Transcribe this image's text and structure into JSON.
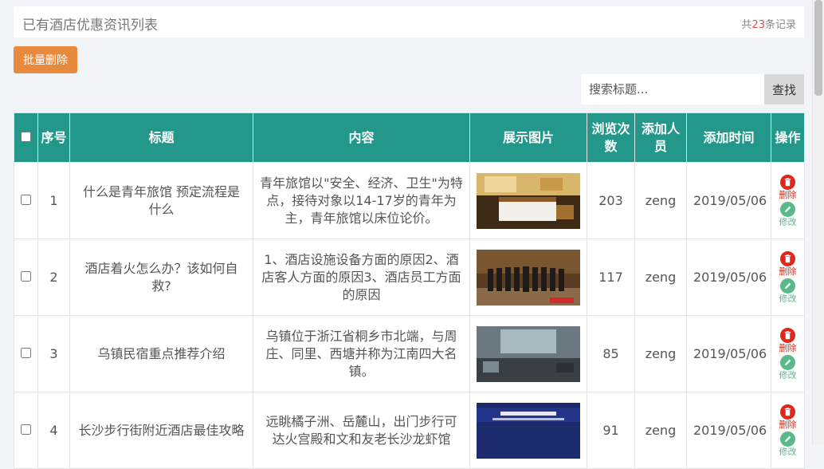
{
  "header": {
    "title": "已有酒店优惠资讯列表",
    "count_prefix": "共",
    "count_value": "23",
    "count_suffix": "条记录"
  },
  "toolbar": {
    "batch_delete_label": "批量删除"
  },
  "search": {
    "placeholder": "搜索标题...",
    "button_label": "查找"
  },
  "table": {
    "columns": [
      "序号",
      "标题",
      "内容",
      "展示图片",
      "浏览次数",
      "添加人员",
      "添加时间",
      "操作"
    ],
    "rows": [
      {
        "index": "1",
        "title": "什么是青年旅馆 预定流程是什么",
        "content": "青年旅馆以\"安全、经济、卫生\"为特点，接待对象以14-17岁的青年为主，青年旅馆以床位论价。",
        "image": "hotel-room-photo",
        "views": "203",
        "author": "zeng",
        "date": "2019/05/06",
        "delete_label": "删除",
        "edit_label": "修改"
      },
      {
        "index": "2",
        "title": "酒店着火怎么办？该如何自救?",
        "content": "1、酒店设施设备方面的原因2、酒店客人方面的原因3、酒店员工方面的原因",
        "image": "hotel-staff-photo",
        "views": "117",
        "author": "zeng",
        "date": "2019/05/06",
        "delete_label": "删除",
        "edit_label": "修改"
      },
      {
        "index": "3",
        "title": "乌镇民宿重点推荐介绍",
        "content": "乌镇位于浙江省桐乡市北端，与周庄、同里、西塘并称为江南四大名镇。",
        "image": "hotel-lobby-photo",
        "views": "85",
        "author": "zeng",
        "date": "2019/05/06",
        "delete_label": "删除",
        "edit_label": "修改"
      },
      {
        "index": "4",
        "title": "长沙步行街附近酒店最佳攻略",
        "content": "远眺橘子洲、岳麓山，出门步行可达火宫殿和文和友老长沙龙虾馆",
        "image": "press-conference-photo",
        "views": "91",
        "author": "zeng",
        "date": "2019/05/06",
        "delete_label": "删除",
        "edit_label": "修改"
      }
    ]
  },
  "colors": {
    "header_bg": "#23988a",
    "batch_delete_bg": "#e88a3d",
    "delete_red": "#e0271a",
    "edit_green": "#5cb88a",
    "count_red": "#d9534f"
  }
}
